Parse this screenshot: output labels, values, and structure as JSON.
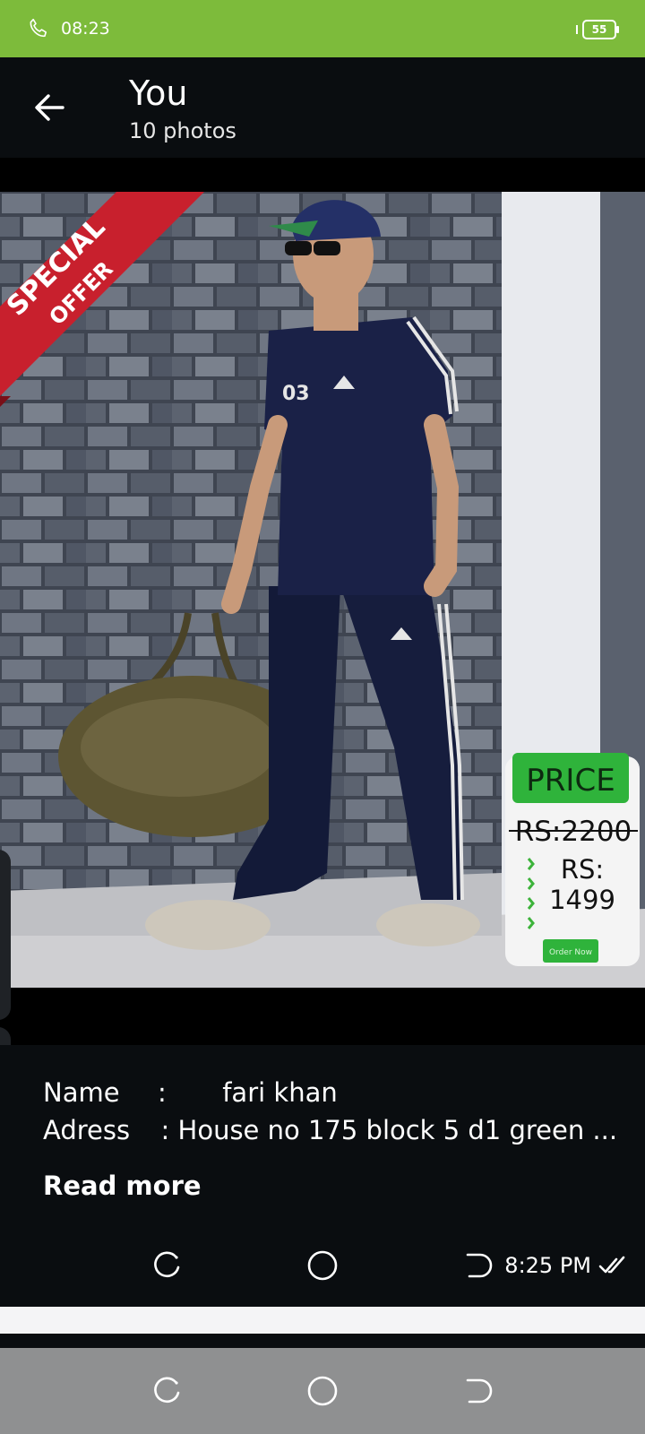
{
  "status_bar": {
    "time": "08:23",
    "battery": "55",
    "icons": [
      "phone-icon",
      "vibrate-icon",
      "battery-icon"
    ]
  },
  "header": {
    "title": "You",
    "subtitle": "10 photos",
    "back_icon": "arrow-left-icon"
  },
  "photo": {
    "banner_line1": "SPECIAL",
    "banner_line2": "OFFER",
    "shirt_number": "03",
    "price_label": "PRICE",
    "old_price": "RS:2200",
    "new_price_label": "RS:",
    "new_price_value": "1499",
    "order_button": "Order Now"
  },
  "caption": {
    "name_label": "Name",
    "name_sep": ":",
    "name_value": "fari khan",
    "address_label": "Adress",
    "address_value": ": House no 175 block 5 d1 green ...",
    "read_more": "Read more",
    "time": "8:25 PM",
    "status_icon": "double-check-icon"
  },
  "nav": {
    "icons": [
      "recent-apps-icon",
      "home-icon",
      "back-icon"
    ]
  },
  "colors": {
    "status_bar": "#7dbb3b",
    "header_bg": "#0a0d10",
    "nav_bar": "#8f9091",
    "offer_red": "#c8202d",
    "price_green": "#2fb33b"
  }
}
